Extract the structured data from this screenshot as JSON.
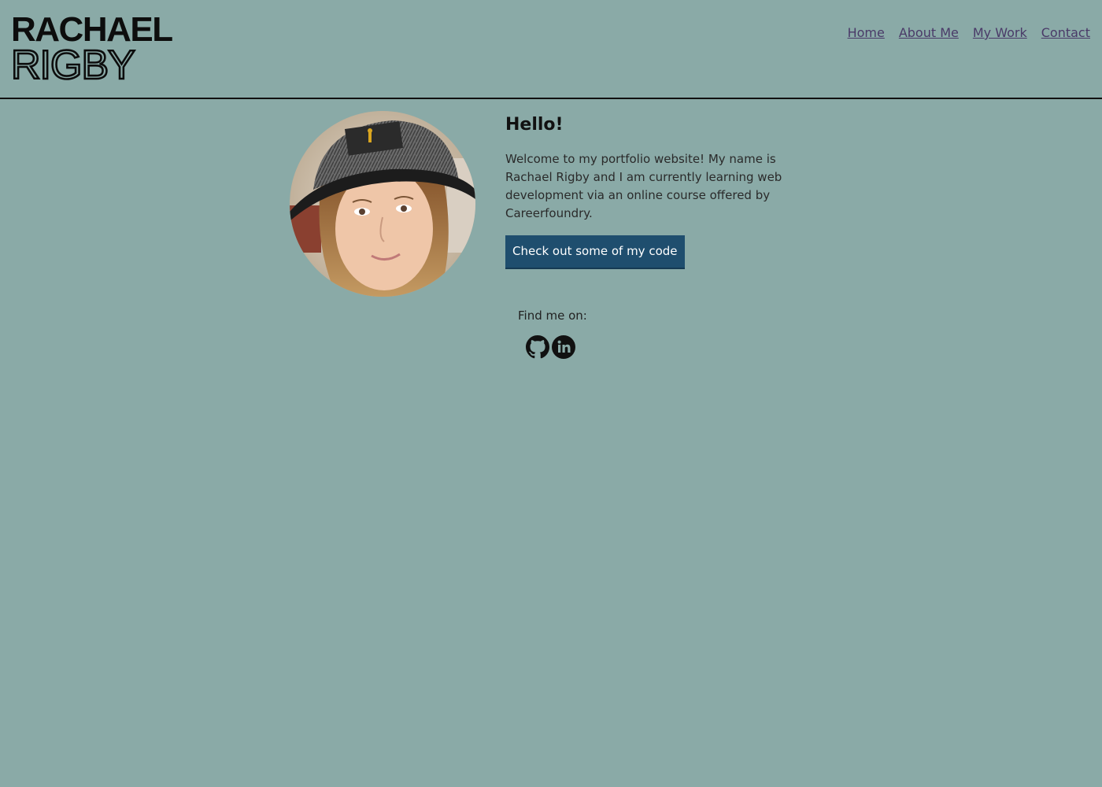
{
  "logo": {
    "line1": "RACHAEL",
    "line2": "RIGBY"
  },
  "nav": {
    "items": [
      {
        "label": "Home"
      },
      {
        "label": "About Me"
      },
      {
        "label": "My Work"
      },
      {
        "label": "Contact"
      }
    ]
  },
  "intro": {
    "heading": "Hello!",
    "body": "Welcome to my portfolio website! My name is Rachael Rigby and I am currently learning web development via an online course offered by Careerfoundry.",
    "cta_label": "Check out some of my code"
  },
  "social": {
    "label": "Find me on:",
    "icons": [
      "github-icon",
      "linkedin-icon"
    ]
  },
  "colors": {
    "background": "#8aaaa7",
    "nav_link": "#4a3a68",
    "button": "#1f4e6e"
  }
}
